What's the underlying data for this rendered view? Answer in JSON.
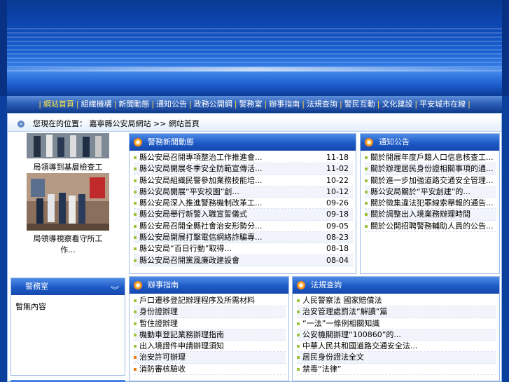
{
  "nav": {
    "items": [
      {
        "label": "網站首頁",
        "active": true
      },
      {
        "label": "組織機構",
        "active": false
      },
      {
        "label": "新聞動態",
        "active": false
      },
      {
        "label": "通知公告",
        "active": false
      },
      {
        "label": "政務公開網",
        "active": false
      },
      {
        "label": "警務室",
        "active": false
      },
      {
        "label": "辦事指南",
        "active": false
      },
      {
        "label": "法規查詢",
        "active": false
      },
      {
        "label": "警民互動",
        "active": false
      },
      {
        "label": "文化建設",
        "active": false
      },
      {
        "label": "平安城市在線",
        "active": false
      }
    ]
  },
  "breadcrumb": {
    "prefix": "您現在的位置： 嘉寧縣公安局網站",
    "separator": ">>",
    "current": "網站首頁"
  },
  "photos": [
    {
      "caption": "局領導到基層檢查工作..."
    },
    {
      "caption": "局領導視察看守所工作..."
    }
  ],
  "news": {
    "title": "警務新聞動態",
    "items": [
      {
        "title": "縣公安局召開專項整治工作推進會...",
        "date": "11-18"
      },
      {
        "title": "縣公安局開展冬季安全防範宣傳活...",
        "date": "11-02"
      },
      {
        "title": "縣公安局組織民警參加業務技能培...",
        "date": "10-22"
      },
      {
        "title": "縣公安局開展“平安校園”創...",
        "date": "10-12"
      },
      {
        "title": "縣公安局深入推進警務機制改革工...",
        "date": "09-26"
      },
      {
        "title": "縣公安局舉行新警入職宣誓儀式",
        "date": "09-18"
      },
      {
        "title": "縣公安局召開全縣社會治安形勢分...",
        "date": "09-05"
      },
      {
        "title": "縣公安局開展打擊電信網絡詐騙專...",
        "date": "08-23"
      },
      {
        "title": "縣公安局“百日行動”取得...",
        "date": "08-18"
      },
      {
        "title": "縣公安局召開黨風廉政建設會",
        "date": "08-04"
      }
    ]
  },
  "notice": {
    "title": "通知公告",
    "items": [
      {
        "title": "關於開展年度戶籍人口信息核查工..."
      },
      {
        "title": "關於辦理居民身份證相關事項的通..."
      },
      {
        "title": "關於進一步加強道路交通安全管理..."
      },
      {
        "title": "縣公安局關於“平安創建”的..."
      },
      {
        "title": "關於徵集違法犯罪線索舉報的通告..."
      },
      {
        "title": "關於調整出入境業務辦理時間"
      },
      {
        "title": "關於公開招聘警務輔助人員的公告..."
      }
    ]
  },
  "leftbox": {
    "title": "警務室",
    "body": "暫無內容"
  },
  "guide": {
    "title": "辦事指南",
    "items": [
      {
        "title": "戶口遷移登記辦理程序及所需材料",
        "marker": "green"
      },
      {
        "title": "身份證辦理",
        "marker": "green"
      },
      {
        "title": "暫住證辦理",
        "marker": "green"
      },
      {
        "title": "機動車登記業務辦理指南",
        "marker": "green"
      },
      {
        "title": "出入境證件申請辦理須知",
        "marker": "green"
      },
      {
        "title": "治安許可辦理",
        "marker": "orange"
      },
      {
        "title": "消防審核驗收",
        "marker": "orange"
      }
    ]
  },
  "law": {
    "title": "法規查詢",
    "items": [
      {
        "title": "人民警察法          國家賠償法"
      },
      {
        "title": "治安管理處罰法“解讀”篇"
      },
      {
        "title": "“一法”一條例相關知識"
      },
      {
        "title": "公安機關辦理“100860”的..."
      },
      {
        "title": "中華人民共和國道路交通安全法..."
      },
      {
        "title": "居民身份證法全文"
      },
      {
        "title": "禁毒“法律”"
      }
    ]
  },
  "colors": {
    "page_bg": "#0b3f9e",
    "panel_header": "#1d5ac6",
    "nav_active": "#ffe84a",
    "nav_separator": "#ffd24a"
  }
}
